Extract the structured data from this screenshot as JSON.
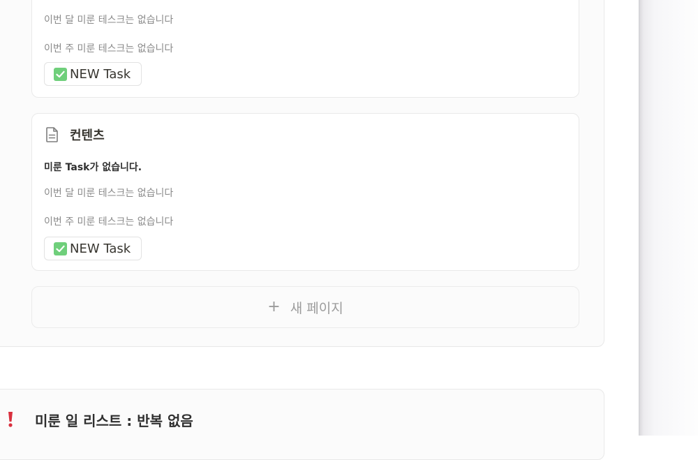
{
  "colors": {
    "accent_check": "#6fcf7b",
    "exclaim": "#d9303e",
    "muted_text": "#8a8a8a"
  },
  "card_top": {
    "month_empty": "이번 달 미룬 테스크는 없습니다",
    "week_empty": "이번 주 미룬 테스크는 없습니다",
    "new_task_label": "NEW Task"
  },
  "card_contents": {
    "icon": "document-icon",
    "title": "컨텐츠",
    "status": "미룬 Task가 없습니다.",
    "month_empty": "이번 달 미룬 테스크는 없습니다",
    "week_empty": "이번 주 미룬 테스크는 없습니다",
    "new_task_label": "NEW Task"
  },
  "new_page": {
    "icon": "plus-icon",
    "label": "새 페이지"
  },
  "section": {
    "icon": "exclamation-icon",
    "title": "미룬 일 리스트 : 반복 없음"
  }
}
